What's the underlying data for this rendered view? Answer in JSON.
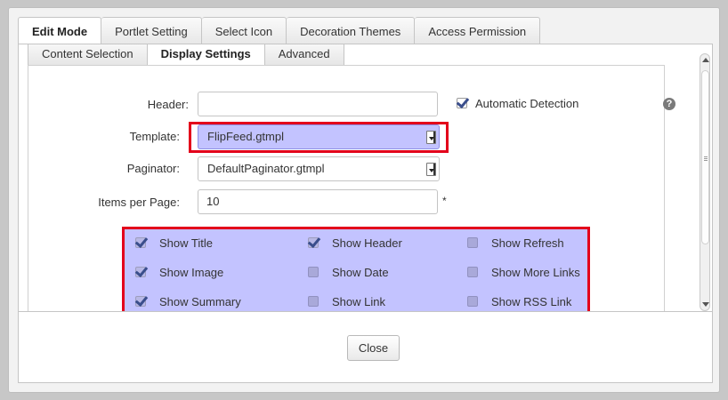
{
  "tabs": [
    "Edit Mode",
    "Portlet Setting",
    "Select Icon",
    "Decoration Themes",
    "Access Permission"
  ],
  "subtabs": [
    "Content Selection",
    "Display Settings",
    "Advanced"
  ],
  "form": {
    "header_label": "Header:",
    "header_value": "",
    "auto_detect_label": "Automatic Detection",
    "template_label": "Template:",
    "template_value": "FlipFeed.gtmpl",
    "paginator_label": "Paginator:",
    "paginator_value": "DefaultPaginator.gtmpl",
    "items_label": "Items per Page:",
    "items_value": "10",
    "required_mark": "*",
    "help_glyph": "?"
  },
  "checkboxes": [
    {
      "label": "Show Title",
      "checked": true
    },
    {
      "label": "Show Header",
      "checked": true
    },
    {
      "label": "Show Refresh",
      "checked": false
    },
    {
      "label": "Show Image",
      "checked": true
    },
    {
      "label": "Show Date",
      "checked": false
    },
    {
      "label": "Show More Links",
      "checked": false
    },
    {
      "label": "Show Summary",
      "checked": true
    },
    {
      "label": "Show Link",
      "checked": false
    },
    {
      "label": "Show RSS Link",
      "checked": false
    }
  ],
  "footer": {
    "close_label": "Close"
  },
  "colors": {
    "highlight": "#c3c3ff",
    "outline": "#e3001b"
  },
  "icons": {
    "help": "help-icon",
    "dropdown": "chevron-down-icon"
  }
}
